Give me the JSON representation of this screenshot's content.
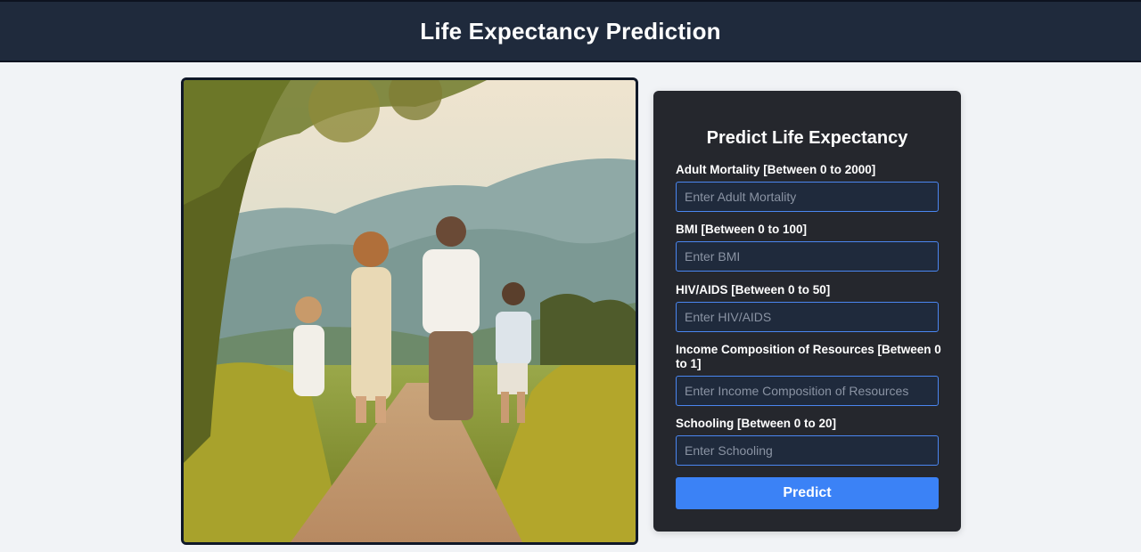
{
  "header": {
    "title": "Life Expectancy Prediction"
  },
  "form": {
    "title": "Predict Life Expectancy",
    "fields": [
      {
        "label": "Adult Mortality [Between 0 to 2000]",
        "placeholder": "Enter Adult Mortality",
        "value": ""
      },
      {
        "label": "BMI [Between 0 to 100]",
        "placeholder": "Enter BMI",
        "value": ""
      },
      {
        "label": "HIV/AIDS [Between 0 to 50]",
        "placeholder": "Enter HIV/AIDS",
        "value": ""
      },
      {
        "label": "Income Composition of Resources [Between 0 to 1]",
        "placeholder": "Enter Income Composition of Resources",
        "value": ""
      },
      {
        "label": "Schooling [Between 0 to 20]",
        "placeholder": "Enter Schooling",
        "value": ""
      }
    ],
    "submit_label": "Predict"
  },
  "colors": {
    "header_bg": "#1f2a3c",
    "page_bg": "#f1f3f6",
    "panel_bg": "#25272d",
    "input_bg": "#1f2a3c",
    "input_border": "#4a86f0",
    "accent": "#3b82f6"
  }
}
